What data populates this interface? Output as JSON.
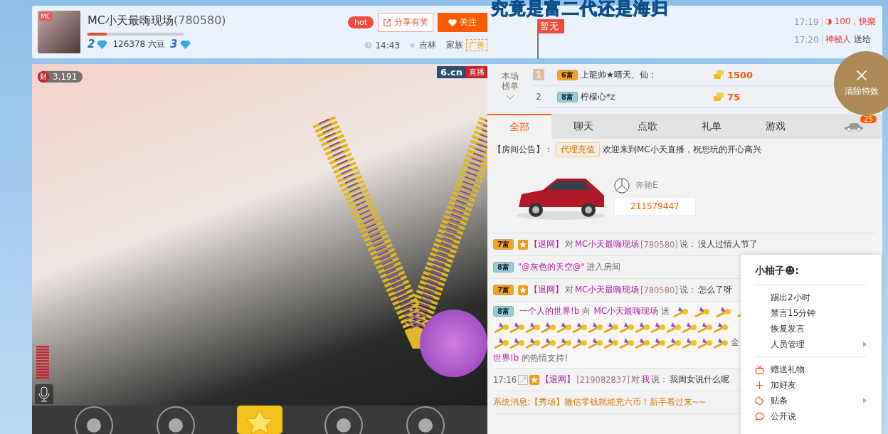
{
  "header": {
    "avatar_logo": "MC",
    "name": "MC小天最嗨现场",
    "room_id": "(780580)",
    "level": 0.2,
    "wealth_level": "2",
    "beans": "126378 六豆",
    "star_level": "3",
    "hot": "hot",
    "share": "分享有奖",
    "follow": "关注",
    "time": "14:43",
    "location": "吉林",
    "family_label": "家族",
    "family": "广善",
    "flag": "暂无"
  },
  "banner": "究竟是富二代还是海归",
  "notices": [
    {
      "kind": "coin",
      "time": "17:19",
      "text": "100，快樂"
    },
    {
      "kind": "gift",
      "time": "17:20",
      "user": "神秘人",
      "text": "送给"
    }
  ],
  "clear_effects": "清除特效",
  "video": {
    "wealth_badge": "财",
    "wealth": "3,191",
    "logo": "6.cn",
    "live": "直播"
  },
  "ranking": {
    "title": "本场榜单",
    "rows": [
      {
        "rank": "1",
        "badge": {
          "label": "6富",
          "color": "#f6a21c"
        },
        "name": "上龍帅★晴天、仙：",
        "coins": "1500"
      },
      {
        "rank": "2",
        "badge": {
          "label": "8富",
          "color": "#8fd0e0"
        },
        "name": "柠檬心*z",
        "coins": "75"
      }
    ]
  },
  "tabs": [
    {
      "label": "全部",
      "selected": true
    },
    {
      "label": "聊天",
      "selected": false
    },
    {
      "label": "点歌",
      "selected": false
    },
    {
      "label": "礼单",
      "selected": false
    },
    {
      "label": "游戏",
      "selected": false
    }
  ],
  "car_count": "25",
  "announcement": {
    "label": "【房间公告】：",
    "button": "代理充值",
    "text": "欢迎来到MC小天直播，祝您玩的开心高兴"
  },
  "car": {
    "brand": "奔驰E",
    "number": "211579447"
  },
  "messages": [
    {
      "kind": "chat",
      "badge": {
        "label": "7富",
        "color": "#f6a21c"
      },
      "user": "【退网】",
      "verb": "对",
      "target": "MC小天最嗨现场",
      "target_id": "[780580]",
      "say": "说：",
      "text": "没人过情人节了"
    },
    {
      "kind": "enter",
      "badge": {
        "label": "8富",
        "color": "#8fd0e0"
      },
      "user": "\"@灰色的天空@\"",
      "text": "进入房间"
    },
    {
      "kind": "chat",
      "badge": {
        "label": "7富",
        "color": "#f6a21c"
      },
      "user": "【退网】",
      "verb": "对",
      "target": "MC小天最嗨现场",
      "target_id": "[780580]",
      "say": "说：",
      "text": "怎么了呀"
    },
    {
      "kind": "gift",
      "badge": {
        "label": "8富",
        "color": "#8fd0e0"
      },
      "user": "一个人的世界!b",
      "verb": "向",
      "target": "MC小天最嗨现场",
      "say": "送",
      "tail": "金",
      "thanks_user": "世界!b",
      "text": "的热情支持!"
    },
    {
      "kind": "private",
      "time": "17:16",
      "user": "【退网】",
      "target_id": "[219082837]",
      "verb": "对",
      "target": "我",
      "say": "说：",
      "text": "我闺女说什么呢"
    },
    {
      "kind": "system",
      "text": "系统消息:【秀场】微信零钱就能充六币！新手看过来~~"
    }
  ],
  "menu": {
    "title": "小柚子☻:",
    "groups": [
      [
        {
          "label": "踢出2小时",
          "kind": "plain",
          "submenu": false
        },
        {
          "label": "禁言15分钟",
          "kind": "plain",
          "submenu": false
        },
        {
          "label": "恢复发言",
          "kind": "plain",
          "submenu": false
        },
        {
          "label": "人员管理",
          "kind": "plain",
          "submenu": true
        }
      ],
      [
        {
          "label": "赠送礼物",
          "kind": "gift",
          "submenu": false
        },
        {
          "label": "加好友",
          "kind": "add",
          "submenu": false
        },
        {
          "label": "贴条",
          "kind": "tag",
          "submenu": true
        },
        {
          "label": "公开说",
          "kind": "chat",
          "submenu": false
        }
      ]
    ]
  }
}
